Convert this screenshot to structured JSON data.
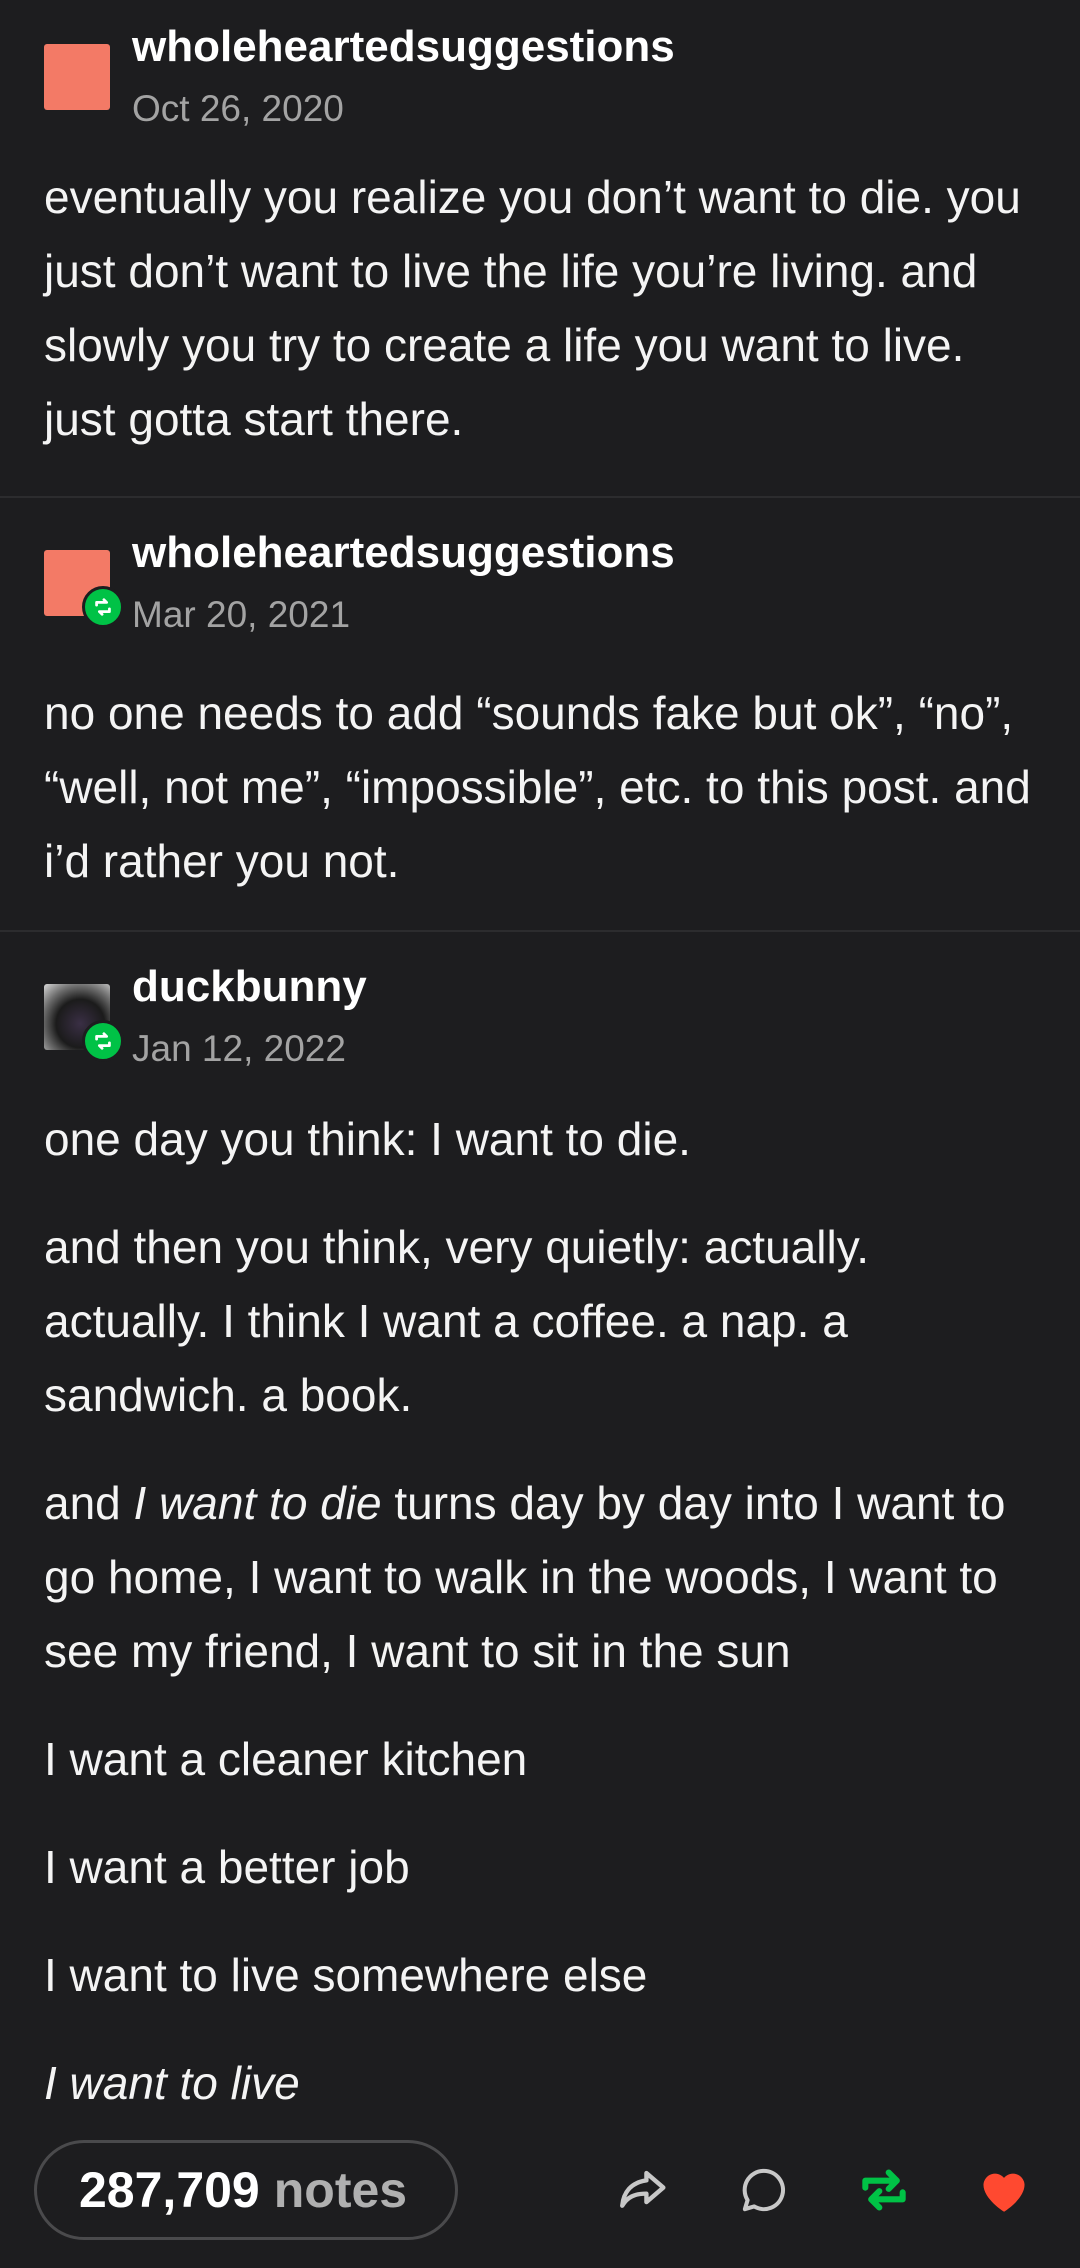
{
  "posts": [
    {
      "username": "wholeheartedsuggestions",
      "date": "Oct 26, 2020",
      "paragraphs": [
        "eventually you realize you don’t want to die. you just don’t want to live the life you’re living. and slowly you try to create a life you want to live. just gotta start there."
      ]
    },
    {
      "username": "wholeheartedsuggestions",
      "date": "Mar 20, 2021",
      "reblog": true,
      "paragraphs": [
        "no one needs to add “sounds fake but ok”, “no”, “well, not me”, “impossible”, etc. to this post. and i’d rather you not."
      ]
    },
    {
      "username": "duckbunny",
      "date": "Jan 12, 2022",
      "reblog": true,
      "paragraphs": [
        "one day you think: I want to die.",
        "and then you think, very quietly: actually. actually. I think I want a coffee. a nap. a sandwich. a book.",
        {
          "pre": "and ",
          "em": "I want to die",
          "post": " turns day by day into I want to go home, I want to walk in the woods, I want to see my friend, I want to sit in the sun"
        },
        "I want a cleaner kitchen",
        "I want a better job",
        "I want to live somewhere else",
        {
          "em": "I want to live"
        }
      ]
    }
  ],
  "footer": {
    "notes_count": "287,709",
    "notes_label": "notes",
    "icons": [
      "share-icon",
      "reply-icon",
      "reblog-icon",
      "like-icon"
    ],
    "colors": {
      "reblog": "#00c246",
      "like": "#ff4930"
    }
  }
}
